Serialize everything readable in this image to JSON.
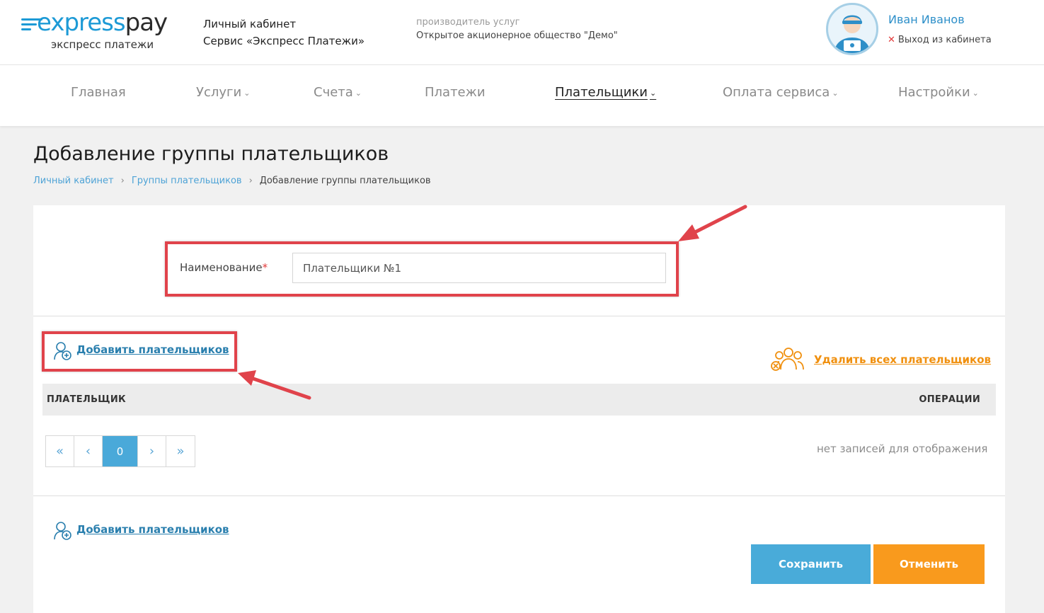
{
  "header": {
    "logo_word_a": "express",
    "logo_word_b": "pay",
    "logo_sub": "экспресс платежи",
    "cabinet_line1": "Личный кабинет",
    "cabinet_line2": "Сервис «Экспресс Платежи»",
    "provider_label": "производитель услуг",
    "provider_value": "Открытое акционерное общество \"Демо\"",
    "user_name": "Иван Иванов",
    "logout_label": "Выход из кабинета"
  },
  "nav": {
    "items": [
      {
        "label": "Главная",
        "has_dropdown": false,
        "active": false
      },
      {
        "label": "Услуги",
        "has_dropdown": true,
        "active": false
      },
      {
        "label": "Счета",
        "has_dropdown": true,
        "active": false
      },
      {
        "label": "Платежи",
        "has_dropdown": false,
        "active": false
      },
      {
        "label": "Плательщики",
        "has_dropdown": true,
        "active": true
      },
      {
        "label": "Оплата сервиса",
        "has_dropdown": true,
        "active": false
      },
      {
        "label": "Настройки",
        "has_dropdown": true,
        "active": false
      }
    ]
  },
  "page": {
    "title": "Добавление группы плательщиков",
    "breadcrumb": [
      "Личный кабинет",
      "Группы плательщиков",
      "Добавление группы плательщиков"
    ]
  },
  "form": {
    "name_label": "Наименование",
    "required_mark": "*",
    "name_value": "Плательщики №1"
  },
  "actions": {
    "add_payers": "Добавить плательщиков",
    "delete_all": "Удалить всех плательщиков",
    "save": "Сохранить",
    "cancel": "Отменить"
  },
  "table": {
    "columns": [
      "ПЛАТЕЛЬЩИК",
      "ОПЕРАЦИИ"
    ],
    "rows": [],
    "empty_text": "нет записей для отображения"
  },
  "pager": {
    "first": "«",
    "prev": "‹",
    "current": "0",
    "next": "›",
    "last": "»"
  },
  "colors": {
    "accent_blue": "#49abd9",
    "accent_orange": "#f99a1d",
    "highlight_red": "#e0434b"
  }
}
